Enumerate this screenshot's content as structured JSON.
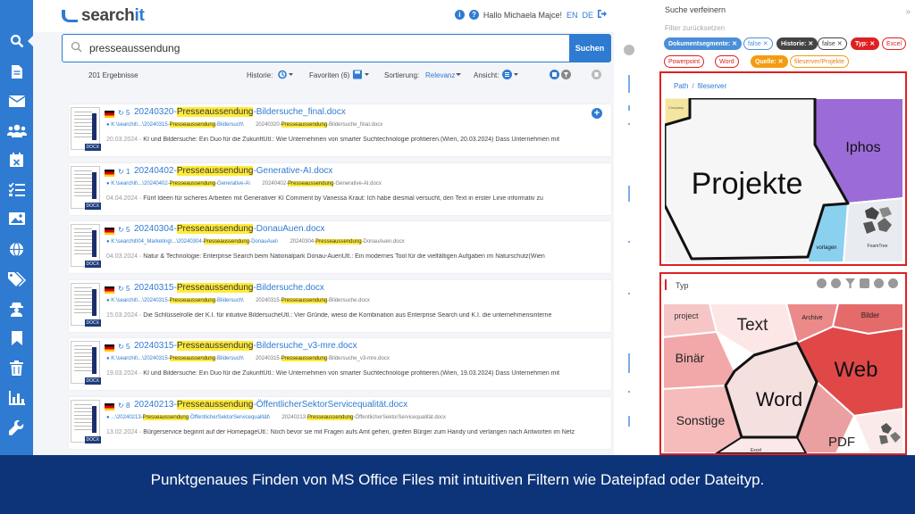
{
  "app": {
    "logo_prefix": "search",
    "logo_suffix": "it",
    "user_greeting": "Hallo Michaela Majce!",
    "lang_en": "EN",
    "lang_de": "DE"
  },
  "search": {
    "query": "presseaussendung",
    "button": "Suchen"
  },
  "toolbar": {
    "count": "201 Ergebnisse",
    "history": "Historie:",
    "favorites": "Favoriten (6)",
    "sort_label": "Sortierung:",
    "sort_value": "Relevanz",
    "view_label": "Ansicht:"
  },
  "results": [
    {
      "ver": "5",
      "pre": "20240320-",
      "hl": "Presseaussendung",
      "post": "-Bildersuche_final.docx",
      "path_a": "K:\\searchit\\...\\20240315-",
      "path_hl": "Presseaussendung",
      "path_b": "-Bildersuch\\",
      "file_a": "20240320-",
      "file_hl": "Presseaussendung",
      "file_b": "-Bildersuche_final.docx",
      "date": "20.03.2024",
      "snippet": "KI und Bildersuche: Ein Duo für die ZukunftUtl.: Wie Unternehmen von smarter Suchtechnologie profitieren.(Wien, 20.03.2024) Dass Unternehmen mit",
      "ext": "DOCX"
    },
    {
      "ver": "1",
      "pre": "20240402-",
      "hl": "Presseaussendung",
      "post": "-Generative-AI.docx",
      "path_a": "K:\\searchit\\...\\20240402-",
      "path_hl": "Presseaussendung",
      "path_b": "-Generative-A\\",
      "file_a": "20240402-",
      "file_hl": "Presseaussendung",
      "file_b": "-Generative-AI.docx",
      "date": "04.04.2024",
      "snippet": "Fünf Ideen für sicheres Arbeiten mit Generativer KI Comment by Vanessa Kraut: Ich habe diesmal versucht, den Text in erster Linie informativ zu",
      "ext": "DOCX"
    },
    {
      "ver": "5",
      "pre": "20240304-",
      "hl": "Presseaussendung",
      "post": "-DonauAuen.docx",
      "path_a": "K:\\searchit\\04_Marketing\\...\\20240304-",
      "path_hl": "Presseaussendung",
      "path_b": "-DonauAue\\",
      "file_a": "20240304-",
      "file_hl": "Presseaussendung",
      "file_b": "-DonauAuen.docx",
      "date": "04.03.2024",
      "snippet": "Natur & Technologie: Enterprise Search beim Nationalpark Donau-AuenUtl.: Ein modernes Tool für die vielfältigen Aufgaben im Naturschutz(Wien",
      "ext": "DOCX"
    },
    {
      "ver": "5",
      "pre": "20240315-",
      "hl": "Presseaussendung",
      "post": "-Bildersuche.docx",
      "path_a": "K:\\searchit\\...\\20240315-",
      "path_hl": "Presseaussendung",
      "path_b": "-Bildersuch\\",
      "file_a": "20240315-",
      "file_hl": "Presseaussendung",
      "file_b": "-Bildersuche.docx",
      "date": "15.03.2024",
      "snippet": "Die Schlüsselrolle der K.I. für intuitive BildersucheUtl.: Vier Gründe, wieso die Kombination aus Enterprise Search und K.I. die unternehmensinterne",
      "ext": "DOCX"
    },
    {
      "ver": "5",
      "pre": "20240315-",
      "hl": "Presseaussendung",
      "post": "-Bildersuche_v3-mre.docx",
      "path_a": "K:\\searchit\\...\\20240315-",
      "path_hl": "Presseaussendung",
      "path_b": "-Bildersuch\\",
      "file_a": "20240315-",
      "file_hl": "Presseaussendung",
      "file_b": "-Bildersuche_v3-mre.docx",
      "date": "19.03.2024",
      "snippet": "KI und Bildersuche: Ein Duo für die ZukunftUtl.: Wie Unternehmen von smarter Suchtechnologie profitieren.(Wien, 19.03.2024) Dass Unternehmen mit",
      "ext": "DOCX"
    },
    {
      "ver": "8",
      "pre": "20240213-",
      "hl": "Presseaussendung",
      "post": "-ÖffentlicherSektorServicequalität.docx",
      "path_a": "...\\20240213-",
      "path_hl": "Presseaussendung",
      "path_b": "-ÖffentlicherSektorServicequalität\\",
      "file_a": "20240213-",
      "file_hl": "Presseaussendung",
      "file_b": "-ÖffentlicherSektorServicequalität.docx",
      "date": "13.02.2024",
      "snippet": "Bürgerservice beginnt auf der HomepageUtl.: Noch bevor sie mit Fragen aufs Amt gehen, greifen Bürger zum Handy und verlangen nach Antworten im Netz",
      "ext": "DOCX"
    }
  ],
  "refine": {
    "title": "Suche verfeinern",
    "reset": "Filter zurücksetzen",
    "chips": {
      "c1": "Dokumentsegmente:",
      "c2": "false",
      "c3": "Historie:",
      "c4": "false",
      "c5": "Typ:",
      "c6": "Excel",
      "c7": "Powerpoint",
      "c8": "Word",
      "c9": "Quelle:",
      "c10": "fileserver/Projekte"
    },
    "path_label": "Path",
    "path_value": "fileserver",
    "treemap1": {
      "projekte": "Projekte",
      "iphos": "Iphos",
      "vorlagen": "vorlagen",
      "company": "Company",
      "foamtree": "FoamTree"
    },
    "typ_label": "Typ",
    "treemap2": {
      "project": "project",
      "text": "Text",
      "archive": "Archive",
      "bilder": "Bilder",
      "binaer": "Binär",
      "web": "Web",
      "word": "Word",
      "sonstige": "Sonstige",
      "pdf": "PDF",
      "excel": "Excel"
    }
  },
  "footer": "Punktgenaues Finden von MS Office Files mit intuitiven Filtern wie Dateipfad oder Dateityp.",
  "colors": {
    "accent": "#2f7bd1",
    "footer": "#0d3478",
    "highlight": "#ffeb3b",
    "frame": "#e02020"
  }
}
